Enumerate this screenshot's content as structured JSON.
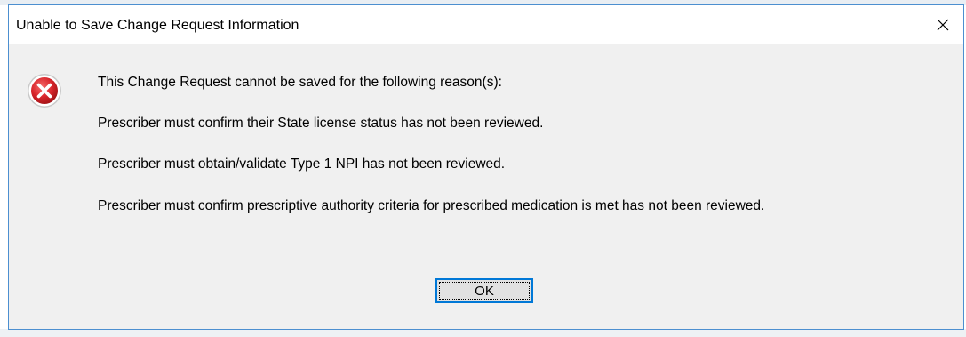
{
  "dialog": {
    "title": "Unable to Save Change Request Information",
    "close_icon": "close-icon",
    "status_icon": "error-icon",
    "status_color": "#d9262c",
    "messages": [
      "This Change Request cannot be saved for the following reason(s):",
      "Prescriber must confirm their State license status has not been reviewed.",
      "Prescriber must obtain/validate Type 1 NPI has not been reviewed.",
      "Prescriber must confirm prescriptive authority criteria for prescribed medication is met has not been reviewed."
    ],
    "ok_label": "OK",
    "accent": "#0078d7"
  }
}
